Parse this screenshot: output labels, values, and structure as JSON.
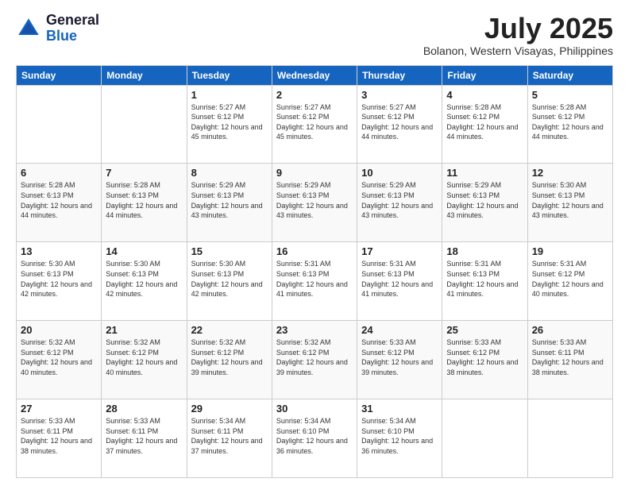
{
  "header": {
    "logo_general": "General",
    "logo_blue": "Blue",
    "month_year": "July 2025",
    "location": "Bolanon, Western Visayas, Philippines"
  },
  "weekdays": [
    "Sunday",
    "Monday",
    "Tuesday",
    "Wednesday",
    "Thursday",
    "Friday",
    "Saturday"
  ],
  "weeks": [
    [
      {
        "day": "",
        "info": ""
      },
      {
        "day": "",
        "info": ""
      },
      {
        "day": "1",
        "info": "Sunrise: 5:27 AM\nSunset: 6:12 PM\nDaylight: 12 hours and 45 minutes."
      },
      {
        "day": "2",
        "info": "Sunrise: 5:27 AM\nSunset: 6:12 PM\nDaylight: 12 hours and 45 minutes."
      },
      {
        "day": "3",
        "info": "Sunrise: 5:27 AM\nSunset: 6:12 PM\nDaylight: 12 hours and 44 minutes."
      },
      {
        "day": "4",
        "info": "Sunrise: 5:28 AM\nSunset: 6:12 PM\nDaylight: 12 hours and 44 minutes."
      },
      {
        "day": "5",
        "info": "Sunrise: 5:28 AM\nSunset: 6:12 PM\nDaylight: 12 hours and 44 minutes."
      }
    ],
    [
      {
        "day": "6",
        "info": "Sunrise: 5:28 AM\nSunset: 6:13 PM\nDaylight: 12 hours and 44 minutes."
      },
      {
        "day": "7",
        "info": "Sunrise: 5:28 AM\nSunset: 6:13 PM\nDaylight: 12 hours and 44 minutes."
      },
      {
        "day": "8",
        "info": "Sunrise: 5:29 AM\nSunset: 6:13 PM\nDaylight: 12 hours and 43 minutes."
      },
      {
        "day": "9",
        "info": "Sunrise: 5:29 AM\nSunset: 6:13 PM\nDaylight: 12 hours and 43 minutes."
      },
      {
        "day": "10",
        "info": "Sunrise: 5:29 AM\nSunset: 6:13 PM\nDaylight: 12 hours and 43 minutes."
      },
      {
        "day": "11",
        "info": "Sunrise: 5:29 AM\nSunset: 6:13 PM\nDaylight: 12 hours and 43 minutes."
      },
      {
        "day": "12",
        "info": "Sunrise: 5:30 AM\nSunset: 6:13 PM\nDaylight: 12 hours and 43 minutes."
      }
    ],
    [
      {
        "day": "13",
        "info": "Sunrise: 5:30 AM\nSunset: 6:13 PM\nDaylight: 12 hours and 42 minutes."
      },
      {
        "day": "14",
        "info": "Sunrise: 5:30 AM\nSunset: 6:13 PM\nDaylight: 12 hours and 42 minutes."
      },
      {
        "day": "15",
        "info": "Sunrise: 5:30 AM\nSunset: 6:13 PM\nDaylight: 12 hours and 42 minutes."
      },
      {
        "day": "16",
        "info": "Sunrise: 5:31 AM\nSunset: 6:13 PM\nDaylight: 12 hours and 41 minutes."
      },
      {
        "day": "17",
        "info": "Sunrise: 5:31 AM\nSunset: 6:13 PM\nDaylight: 12 hours and 41 minutes."
      },
      {
        "day": "18",
        "info": "Sunrise: 5:31 AM\nSunset: 6:13 PM\nDaylight: 12 hours and 41 minutes."
      },
      {
        "day": "19",
        "info": "Sunrise: 5:31 AM\nSunset: 6:12 PM\nDaylight: 12 hours and 40 minutes."
      }
    ],
    [
      {
        "day": "20",
        "info": "Sunrise: 5:32 AM\nSunset: 6:12 PM\nDaylight: 12 hours and 40 minutes."
      },
      {
        "day": "21",
        "info": "Sunrise: 5:32 AM\nSunset: 6:12 PM\nDaylight: 12 hours and 40 minutes."
      },
      {
        "day": "22",
        "info": "Sunrise: 5:32 AM\nSunset: 6:12 PM\nDaylight: 12 hours and 39 minutes."
      },
      {
        "day": "23",
        "info": "Sunrise: 5:32 AM\nSunset: 6:12 PM\nDaylight: 12 hours and 39 minutes."
      },
      {
        "day": "24",
        "info": "Sunrise: 5:33 AM\nSunset: 6:12 PM\nDaylight: 12 hours and 39 minutes."
      },
      {
        "day": "25",
        "info": "Sunrise: 5:33 AM\nSunset: 6:12 PM\nDaylight: 12 hours and 38 minutes."
      },
      {
        "day": "26",
        "info": "Sunrise: 5:33 AM\nSunset: 6:11 PM\nDaylight: 12 hours and 38 minutes."
      }
    ],
    [
      {
        "day": "27",
        "info": "Sunrise: 5:33 AM\nSunset: 6:11 PM\nDaylight: 12 hours and 38 minutes."
      },
      {
        "day": "28",
        "info": "Sunrise: 5:33 AM\nSunset: 6:11 PM\nDaylight: 12 hours and 37 minutes."
      },
      {
        "day": "29",
        "info": "Sunrise: 5:34 AM\nSunset: 6:11 PM\nDaylight: 12 hours and 37 minutes."
      },
      {
        "day": "30",
        "info": "Sunrise: 5:34 AM\nSunset: 6:10 PM\nDaylight: 12 hours and 36 minutes."
      },
      {
        "day": "31",
        "info": "Sunrise: 5:34 AM\nSunset: 6:10 PM\nDaylight: 12 hours and 36 minutes."
      },
      {
        "day": "",
        "info": ""
      },
      {
        "day": "",
        "info": ""
      }
    ]
  ]
}
